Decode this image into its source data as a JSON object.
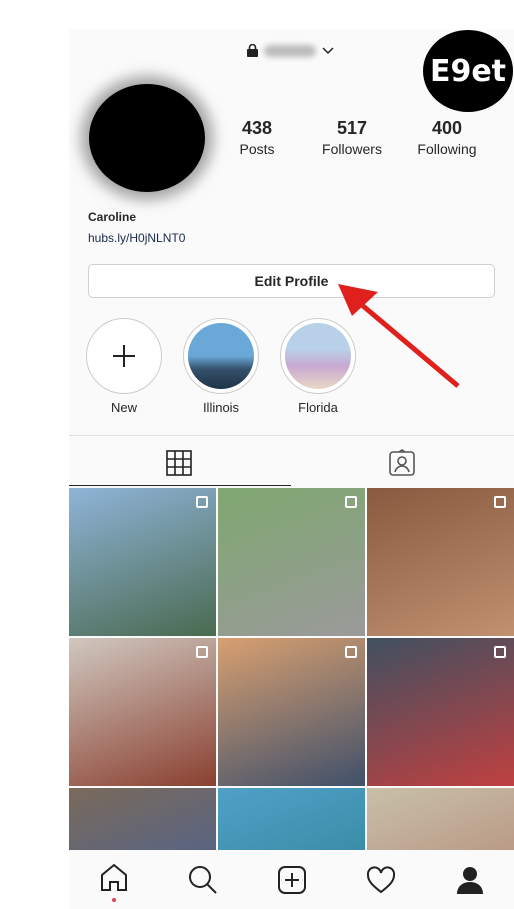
{
  "header": {
    "username_blurred": true,
    "lock_icon": "lock-icon",
    "dropdown_icon": "chevron-down-icon"
  },
  "watermark": "E9et",
  "stats": [
    {
      "value": "438",
      "label": "Posts"
    },
    {
      "value": "517",
      "label": "Followers"
    },
    {
      "value": "400",
      "label": "Following"
    }
  ],
  "profile": {
    "name": "Caroline",
    "link": "hubs.ly/H0jNLNT0"
  },
  "edit_profile": "Edit Profile",
  "highlights": [
    {
      "label": "New"
    },
    {
      "label": "Illinois"
    },
    {
      "label": "Florida"
    }
  ],
  "tabs": [
    {
      "icon": "grid-icon",
      "active": true
    },
    {
      "icon": "tagged-icon",
      "active": false
    }
  ],
  "posts": [
    {
      "colors": [
        "#8fb4d8",
        "#4a6a50"
      ]
    },
    {
      "colors": [
        "#7fa870",
        "#9a9a9a"
      ]
    },
    {
      "colors": [
        "#8a5a40",
        "#c09070"
      ]
    },
    {
      "colors": [
        "#d0c8c0",
        "#8a4030"
      ]
    },
    {
      "colors": [
        "#d8a070",
        "#40506a"
      ]
    },
    {
      "colors": [
        "#405060",
        "#c04040"
      ]
    },
    {
      "colors": [
        "#7a6a5a",
        "#4060a0"
      ]
    },
    {
      "colors": [
        "#50a0c8",
        "#2a8090"
      ]
    },
    {
      "colors": [
        "#c8c0a8",
        "#b08070"
      ]
    }
  ],
  "nav": [
    {
      "icon": "home-icon"
    },
    {
      "icon": "search-icon"
    },
    {
      "icon": "add-post-icon"
    },
    {
      "icon": "heart-icon"
    },
    {
      "icon": "profile-icon"
    }
  ],
  "colors": {
    "annotation_arrow": "#e0201c",
    "notification_dot": "#e04060"
  }
}
